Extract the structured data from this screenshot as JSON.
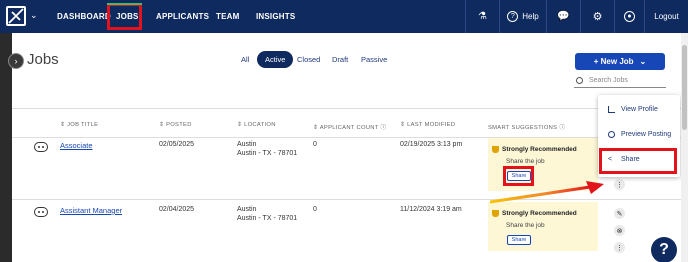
{
  "nav": {
    "items": [
      "DASHBOARD",
      "JOBS",
      "APPLICANTS",
      "TEAM",
      "INSIGHTS"
    ],
    "active": "JOBS",
    "help_label": "Help",
    "logout_label": "Logout"
  },
  "page": {
    "title": "Jobs",
    "filters": [
      "All",
      "Active",
      "Closed",
      "Draft",
      "Passive"
    ],
    "active_filter": "Active",
    "new_job_label": "+ New Job",
    "search_placeholder": "Search Jobs"
  },
  "table": {
    "headers": [
      "JOB TITLE",
      "POSTED",
      "LOCATION",
      "APPLICANT COUNT",
      "LAST MODIFIED",
      "SMART SUGGESTIONS"
    ],
    "rows": [
      {
        "title": "Associate",
        "posted": "02/05/2025",
        "location_city": "Austin",
        "location_full": "Austin - TX - 78701",
        "applicant_count": "0",
        "last_modified": "02/19/2025 3:13 pm",
        "suggestion_title": "Strongly Recommended",
        "suggestion_text": "Share the job",
        "suggestion_button": "Share"
      },
      {
        "title": "Assistant Manager",
        "posted": "02/04/2025",
        "location_city": "Austin",
        "location_full": "Austin - TX - 78701",
        "applicant_count": "0",
        "last_modified": "11/12/2024 3:19 am",
        "suggestion_title": "Strongly Recommended",
        "suggestion_text": "Share the job",
        "suggestion_button": "Share"
      }
    ]
  },
  "menu": {
    "items": [
      "View Profile",
      "Preview Posting",
      "Share"
    ],
    "highlighted": "Share"
  },
  "colors": {
    "nav_bg": "#0f2a5f",
    "primary": "#1746b6",
    "highlight_red": "#e3131b",
    "suggestion_bg": "#fdf7d6"
  },
  "icons": [
    "logo-icon",
    "flask-icon",
    "help-icon",
    "chat-icon",
    "gear-icon",
    "user-icon",
    "search-icon",
    "robot-icon",
    "trophy-icon",
    "kebab-icon",
    "chart-icon",
    "eye-icon",
    "share-icon",
    "edit-icon",
    "close-circle-icon",
    "question-icon"
  ]
}
